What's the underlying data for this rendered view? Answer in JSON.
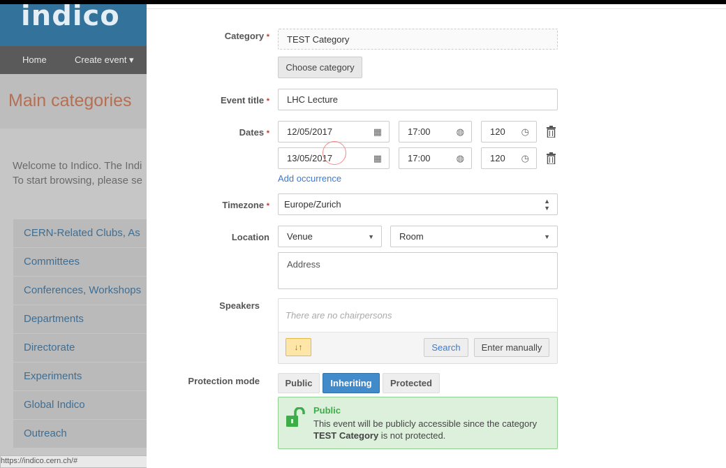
{
  "background": {
    "logo": "indico",
    "nav": {
      "home": "Home",
      "create_event": "Create event ▾"
    },
    "title": "Main categories",
    "welcome_line1": "Welcome to Indico. The Indi",
    "welcome_line2": "To start browsing, please se",
    "categories": [
      "CERN-Related Clubs, As",
      "Committees",
      "Conferences, Workshops",
      "Departments",
      "Directorate",
      "Experiments",
      "Global Indico",
      "Outreach"
    ],
    "status_url": "https://indico.cern.ch/#"
  },
  "form": {
    "category": {
      "label": "Category",
      "value": "TEST Category",
      "button": "Choose category"
    },
    "event_title": {
      "label": "Event title",
      "value": "LHC Lecture"
    },
    "dates": {
      "label": "Dates",
      "rows": [
        {
          "date": "12/05/2017",
          "time": "17:00",
          "duration": "120"
        },
        {
          "date": "13/05/2017",
          "time": "17:00",
          "duration": "120"
        }
      ],
      "add_occurrence": "Add occurrence"
    },
    "timezone": {
      "label": "Timezone",
      "value": "Europe/Zurich"
    },
    "location": {
      "label": "Location",
      "venue": "Venue",
      "room": "Room",
      "address_placeholder": "Address"
    },
    "speakers": {
      "label": "Speakers",
      "empty_text": "There are no chairpersons",
      "sort_icon": "↓↑",
      "search": "Search",
      "enter_manually": "Enter manually"
    },
    "protection": {
      "label": "Protection mode",
      "options": [
        "Public",
        "Inheriting",
        "Protected"
      ],
      "selected": "Inheriting",
      "alert_title": "Public",
      "alert_text_1": "This event will be publicly accessible since the category",
      "alert_text_2_bold": "TEST Category",
      "alert_text_2_rest": " is not protected."
    },
    "required_mark": "*"
  },
  "colors": {
    "accent": "#3a7bd5",
    "selected_button": "#428bca",
    "success": "#3cad48",
    "required": "#c0392b"
  }
}
